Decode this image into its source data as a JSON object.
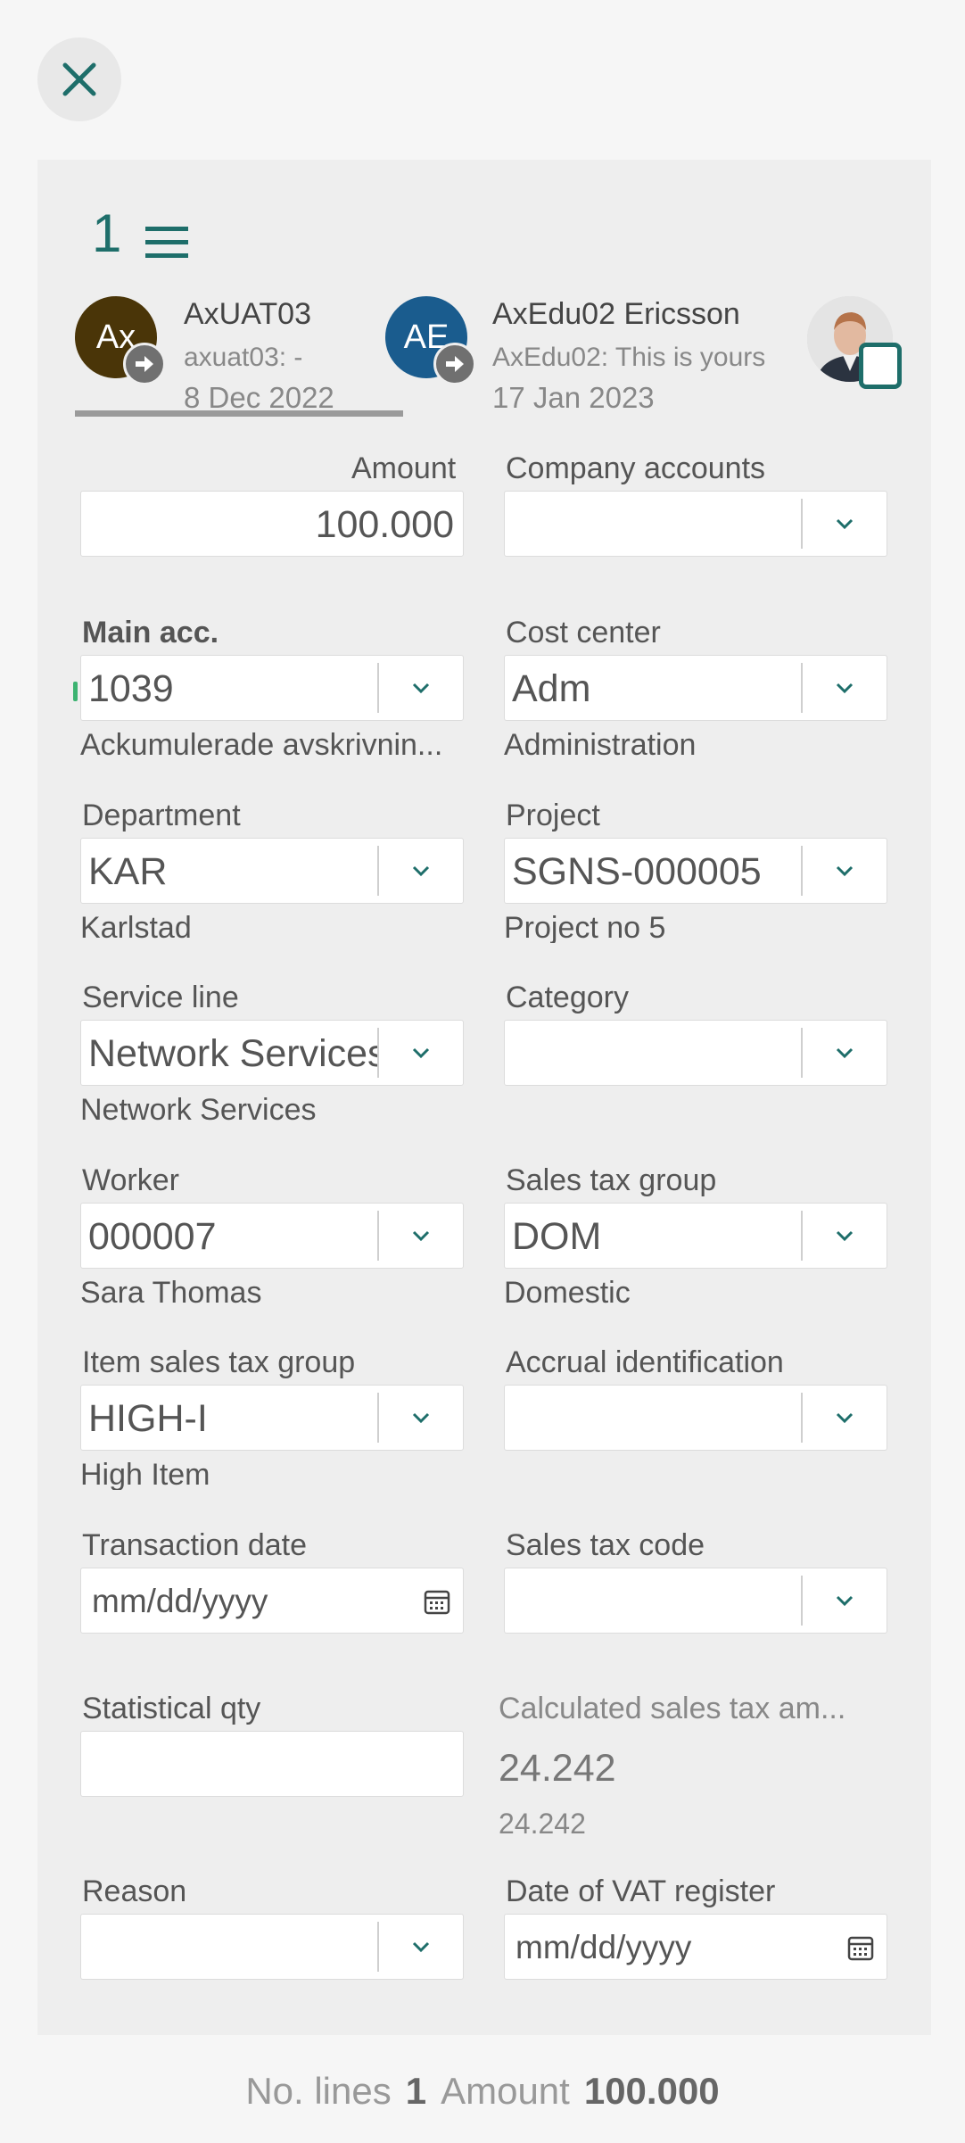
{
  "header": {
    "line_number": "1",
    "events": [
      {
        "initials": "Ax",
        "color": "#4a3508",
        "title": "AxUAT03",
        "subtitle": "axuat03: -",
        "date": "8 Dec 2022"
      },
      {
        "initials": "AE",
        "color": "#1a5c8e",
        "title": "AxEdu02 Ericsson",
        "subtitle": "AxEdu02: This is yours",
        "date": "17 Jan 2023"
      }
    ]
  },
  "form": {
    "amount": {
      "label": "Amount",
      "value": "100.000"
    },
    "company_accounts": {
      "label": "Company accounts",
      "value": ""
    },
    "main_acc": {
      "label": "Main acc.",
      "value": "1039",
      "desc": "Ackumulerade avskrivnin..."
    },
    "cost_center": {
      "label": "Cost center",
      "value": "Adm",
      "desc": "Administration"
    },
    "department": {
      "label": "Department",
      "value": "KAR",
      "desc": "Karlstad"
    },
    "project": {
      "label": "Project",
      "value": "SGNS-000005",
      "desc": "Project no 5"
    },
    "service_line": {
      "label": "Service line",
      "value": "Network Services",
      "desc": "Network Services"
    },
    "category": {
      "label": "Category",
      "value": ""
    },
    "worker": {
      "label": "Worker",
      "value": "000007",
      "desc": "Sara Thomas"
    },
    "sales_tax_group": {
      "label": "Sales tax group",
      "value": "DOM",
      "desc": "Domestic"
    },
    "item_sales_tax_group": {
      "label": "Item sales tax group",
      "value": "HIGH-I",
      "desc": "High Item"
    },
    "accrual_identification": {
      "label": "Accrual identification",
      "value": ""
    },
    "transaction_date": {
      "label": "Transaction date",
      "placeholder": "mm/dd/yyyy"
    },
    "sales_tax_code": {
      "label": "Sales tax code",
      "value": ""
    },
    "statistical_qty": {
      "label": "Statistical qty",
      "value": ""
    },
    "calculated_sales_tax": {
      "label": "Calculated sales tax am...",
      "value": "24.242",
      "sub": "24.242"
    },
    "reason": {
      "label": "Reason",
      "value": ""
    },
    "date_vat_register": {
      "label": "Date of VAT register",
      "placeholder": "mm/dd/yyyy"
    }
  },
  "footer": {
    "lines_label": "No. lines",
    "lines_value": "1",
    "amount_label": "Amount",
    "amount_value": "100.000"
  },
  "colors": {
    "accent": "#1e6e6a",
    "panel": "#eeeeee",
    "page": "#f6f6f6"
  }
}
